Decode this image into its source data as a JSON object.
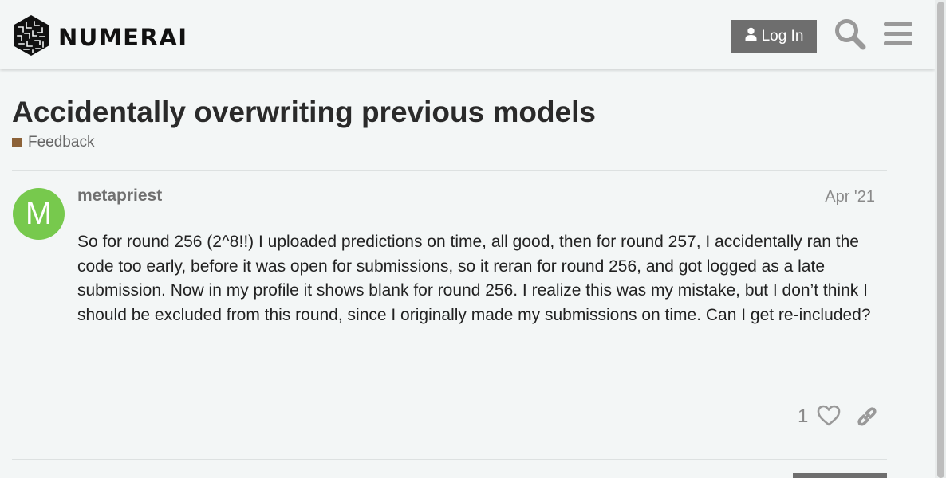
{
  "site": {
    "brand": "NUMERAI",
    "login_label": "Log In"
  },
  "topic": {
    "title": "Accidentally overwriting previous models",
    "category": "Feedback",
    "category_color": "#8c6238"
  },
  "post": {
    "avatar_letter": "M",
    "avatar_color": "#77c94d",
    "username": "metapriest",
    "date": "Apr '21",
    "body": "So for round 256 (2^8!!) I uploaded predictions on time, all good, then for round 257, I accidentally ran the code too early, before it was open for submissions, so it reran for round 256, and got logged as a late submission. Now in my profile it shows blank for round 256. I realize this was my mistake, but I don’t think I should be excluded from this round, since I originally made my submissions on time. Can I get re-included?",
    "like_count": "1"
  },
  "icons": {
    "logo": "numerai-logo-icon",
    "user": "user-icon",
    "search": "search-icon",
    "menu": "hamburger-menu-icon",
    "like": "heart-icon",
    "link": "link-icon"
  }
}
